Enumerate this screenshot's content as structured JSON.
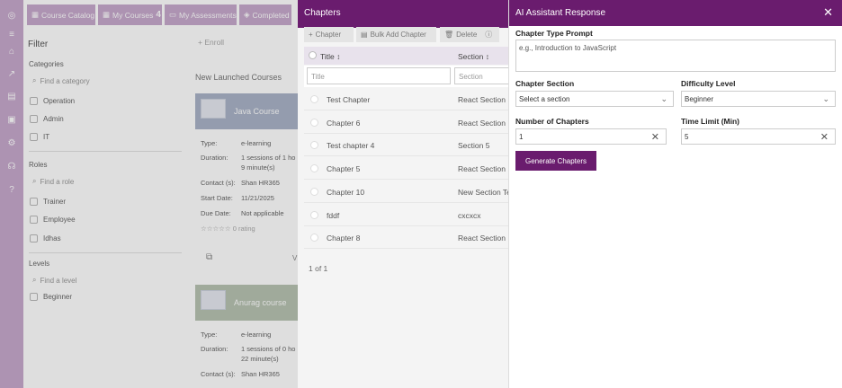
{
  "tabs": [
    {
      "icon": "catalog-icon",
      "label": "Course Catalog",
      "count": ""
    },
    {
      "icon": "courses-icon",
      "label": "My Courses",
      "count": "4"
    },
    {
      "icon": "assessments-icon",
      "label": "My Assessments",
      "count": ""
    },
    {
      "icon": "completed-icon",
      "label": "Completed",
      "count": ""
    }
  ],
  "filter": {
    "title": "Filter",
    "categories_label": "Categories",
    "categories_placeholder": "Find a category",
    "categories": [
      "Operation",
      "Admin",
      "IT"
    ],
    "roles_label": "Roles",
    "roles_placeholder": "Find a role",
    "roles": [
      "Trainer",
      "Employee",
      "Idhas"
    ],
    "levels_label": "Levels",
    "levels_placeholder": "Find a level",
    "levels": [
      "Beginner"
    ]
  },
  "center": {
    "add_label": "Enroll",
    "section_title": "New Launched Courses",
    "card1": {
      "title": "Java Course",
      "type_label": "Type:",
      "type": "e-learning",
      "duration_label": "Duration:",
      "duration1": "1 sessions of 1 ho",
      "duration2": "9 minute(s)",
      "contact_label": "Contact (s):",
      "contact": "Shan HR365",
      "start_label": "Start Date:",
      "start": "11/21/2025",
      "due_label": "Due Date:",
      "due": "Not applicable",
      "rating": "☆☆☆☆☆ 0 rating"
    },
    "card2": {
      "title": "Anurag course",
      "type_label": "Type:",
      "type": "e-learning",
      "duration_label": "Duration:",
      "duration1": "1 sessions of 0 ho",
      "duration2": "22 minute(s)",
      "contact_label": "Contact (s):",
      "contact": "Shan HR365"
    }
  },
  "chapters": {
    "title": "Chapters",
    "toolbar": {
      "add": "Chapter",
      "bulk": "Bulk Add Chapter",
      "delete": "Delete"
    },
    "col_title": "Title",
    "col_section": "Section",
    "title_placeholder": "Title",
    "section_placeholder": "Section",
    "rows": [
      {
        "title": "Test Chapter",
        "section": "React Section"
      },
      {
        "title": "Chapter 6",
        "section": "React Section"
      },
      {
        "title": "Test chapter 4",
        "section": "Section 5"
      },
      {
        "title": "Chapter 5",
        "section": "React Section"
      },
      {
        "title": "Chapter 10",
        "section": "New Section Te"
      },
      {
        "title": "fddf",
        "section": "cxcxcx"
      },
      {
        "title": "Chapter 8",
        "section": "React Section"
      }
    ],
    "pagination": "1 of 1"
  },
  "ai": {
    "title": "AI Assistant Response",
    "prompt_label": "Chapter Type Prompt",
    "prompt_placeholder": "e.g., Introduction to JavaScript",
    "section_label": "Chapter Section",
    "section_value": "Select a section",
    "difficulty_label": "Difficulty Level",
    "difficulty_value": "Beginner",
    "num_label": "Number of Chapters",
    "num_value": "1",
    "time_label": "Time Limit (Min)",
    "time_value": "5",
    "generate": "Generate Chapters"
  },
  "colors": {
    "accent": "#6a1c6e",
    "rail": "#c7a9cd",
    "card": "#aab4c8"
  }
}
